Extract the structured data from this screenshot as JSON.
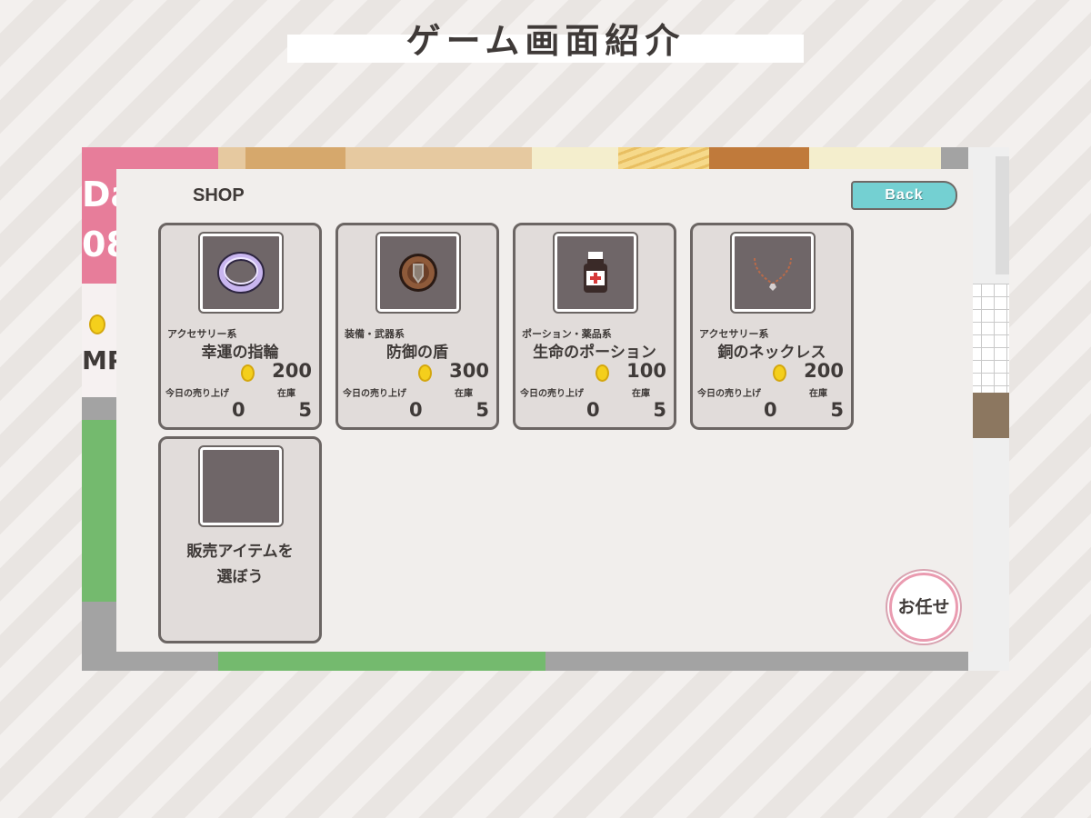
{
  "page": {
    "title": "ゲーム画面紹介"
  },
  "hud": {
    "day_partial": "Da",
    "number_partial": "08",
    "mp_partial": "MP"
  },
  "shop": {
    "title": "SHOP",
    "back_label": "Back",
    "items": [
      {
        "icon": "ring-icon",
        "category": "アクセサリー系",
        "name": "幸運の指輪",
        "price": "200",
        "sales_label": "今日の売り上げ",
        "sales": "0",
        "stock_label": "在庫",
        "stock": "5"
      },
      {
        "icon": "shield-icon",
        "category": "装備・武器系",
        "name": "防御の盾",
        "price": "300",
        "sales_label": "今日の売り上げ",
        "sales": "0",
        "stock_label": "在庫",
        "stock": "5"
      },
      {
        "icon": "potion-icon",
        "category": "ポーション・薬品系",
        "name": "生命のポーション",
        "price": "100",
        "sales_label": "今日の売り上げ",
        "sales": "0",
        "stock_label": "在庫",
        "stock": "5"
      },
      {
        "icon": "necklace-icon",
        "category": "アクセサリー系",
        "name": "銅のネックレス",
        "price": "200",
        "sales_label": "今日の売り上げ",
        "sales": "0",
        "stock_label": "在庫",
        "stock": "5"
      }
    ],
    "empty_slot": {
      "line1": "販売アイテムを",
      "line2": "選ぼう"
    },
    "omakase_label": "お任せ"
  },
  "colors": {
    "panel": "#f1eeec",
    "card": "#e1dcda",
    "icon_bg": "#6f6668",
    "back_button": "#74d0d2",
    "coin": "#f4cf1c",
    "text": "#3f3a38"
  }
}
